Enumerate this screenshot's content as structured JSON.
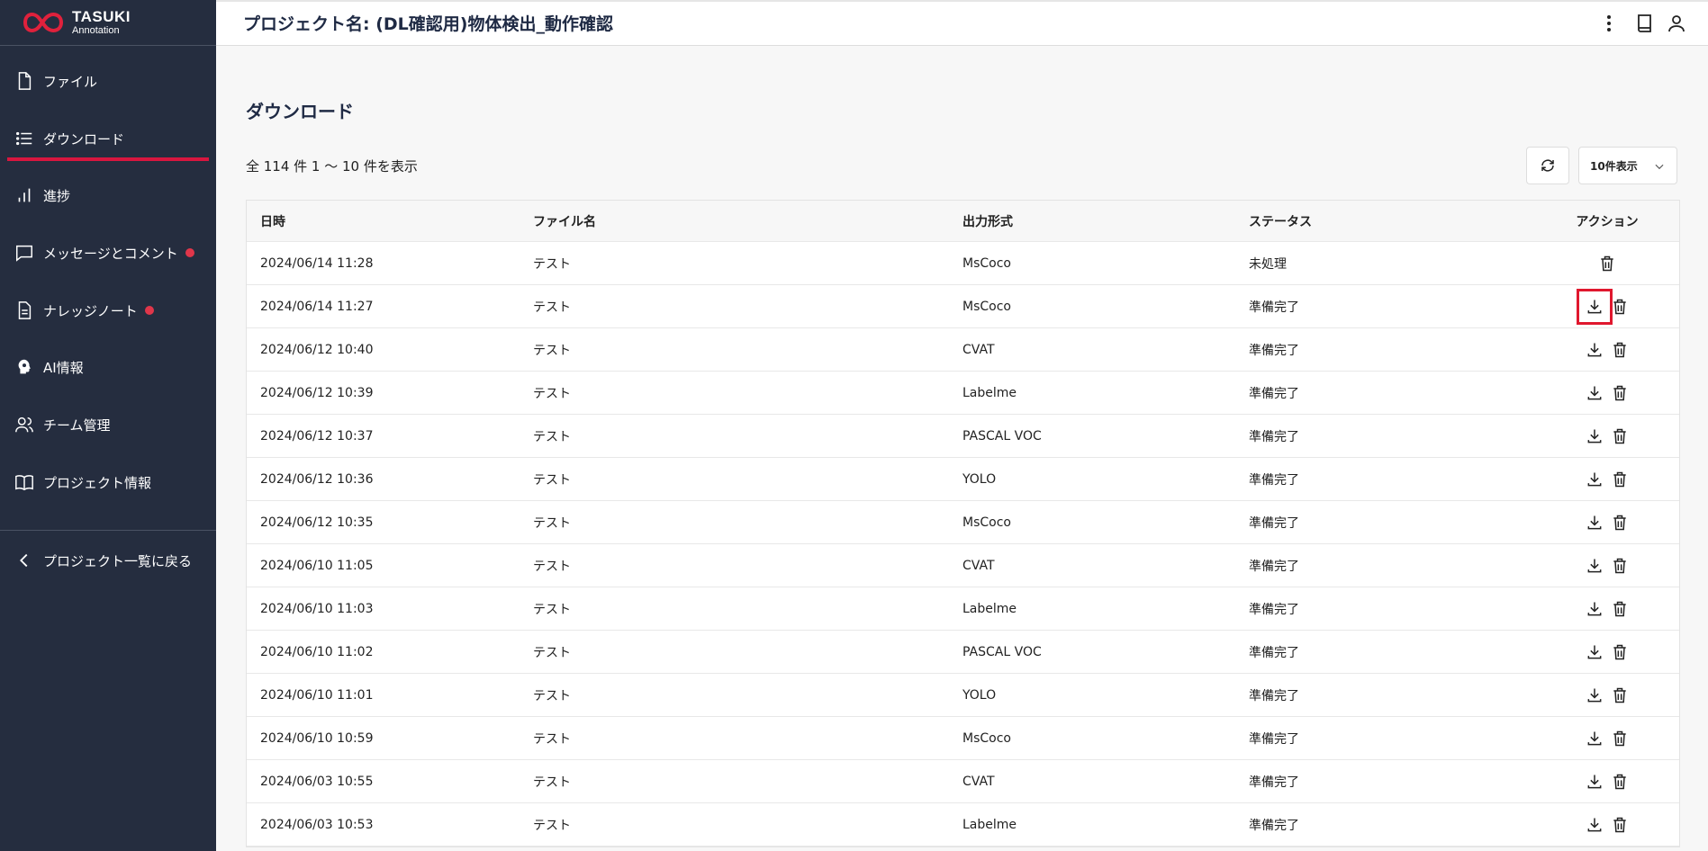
{
  "brand": {
    "name": "TASUKI",
    "sub": "Annotation",
    "accent": "#d8163f",
    "sidebar_bg": "#252d3f"
  },
  "sidebar": {
    "items": [
      {
        "label": "ファイル",
        "icon": "file-icon"
      },
      {
        "label": "ダウンロード",
        "icon": "list-icon",
        "active": true
      },
      {
        "label": "進捗",
        "icon": "bar-chart-icon"
      },
      {
        "label": "メッセージとコメント",
        "icon": "message-icon",
        "badge": true
      },
      {
        "label": "ナレッジノート",
        "icon": "document-icon",
        "badge": true
      },
      {
        "label": "AI情報",
        "icon": "ai-head-icon"
      },
      {
        "label": "チーム管理",
        "icon": "users-icon"
      },
      {
        "label": "プロジェクト情報",
        "icon": "book-icon"
      }
    ],
    "back_label": "プロジェクト一覧に戻る"
  },
  "header": {
    "project_title": "プロジェクト名: (DL確認用)物体検出_動作確認"
  },
  "main": {
    "heading": "ダウンロード",
    "count_text": "全 114 件 1 〜 10 件を表示",
    "per_page": "10件表示"
  },
  "table": {
    "columns": [
      "日時",
      "ファイル名",
      "出力形式",
      "ステータス",
      "アクション"
    ],
    "rows": [
      {
        "date": "2024/06/14 11:28",
        "file": "テスト",
        "format": "MsCoco",
        "status": "未処理",
        "download": false
      },
      {
        "date": "2024/06/14 11:27",
        "file": "テスト",
        "format": "MsCoco",
        "status": "準備完了",
        "download": true,
        "highlighted": true
      },
      {
        "date": "2024/06/12 10:40",
        "file": "テスト",
        "format": "CVAT",
        "status": "準備完了",
        "download": true
      },
      {
        "date": "2024/06/12 10:39",
        "file": "テスト",
        "format": "Labelme",
        "status": "準備完了",
        "download": true
      },
      {
        "date": "2024/06/12 10:37",
        "file": "テスト",
        "format": "PASCAL VOC",
        "status": "準備完了",
        "download": true
      },
      {
        "date": "2024/06/12 10:36",
        "file": "テスト",
        "format": "YOLO",
        "status": "準備完了",
        "download": true
      },
      {
        "date": "2024/06/12 10:35",
        "file": "テスト",
        "format": "MsCoco",
        "status": "準備完了",
        "download": true
      },
      {
        "date": "2024/06/10 11:05",
        "file": "テスト",
        "format": "CVAT",
        "status": "準備完了",
        "download": true
      },
      {
        "date": "2024/06/10 11:03",
        "file": "テスト",
        "format": "Labelme",
        "status": "準備完了",
        "download": true
      },
      {
        "date": "2024/06/10 11:02",
        "file": "テスト",
        "format": "PASCAL VOC",
        "status": "準備完了",
        "download": true
      },
      {
        "date": "2024/06/10 11:01",
        "file": "テスト",
        "format": "YOLO",
        "status": "準備完了",
        "download": true
      },
      {
        "date": "2024/06/10 10:59",
        "file": "テスト",
        "format": "MsCoco",
        "status": "準備完了",
        "download": true
      },
      {
        "date": "2024/06/03 10:55",
        "file": "テスト",
        "format": "CVAT",
        "status": "準備完了",
        "download": true
      },
      {
        "date": "2024/06/03 10:53",
        "file": "テスト",
        "format": "Labelme",
        "status": "準備完了",
        "download": true
      }
    ]
  }
}
